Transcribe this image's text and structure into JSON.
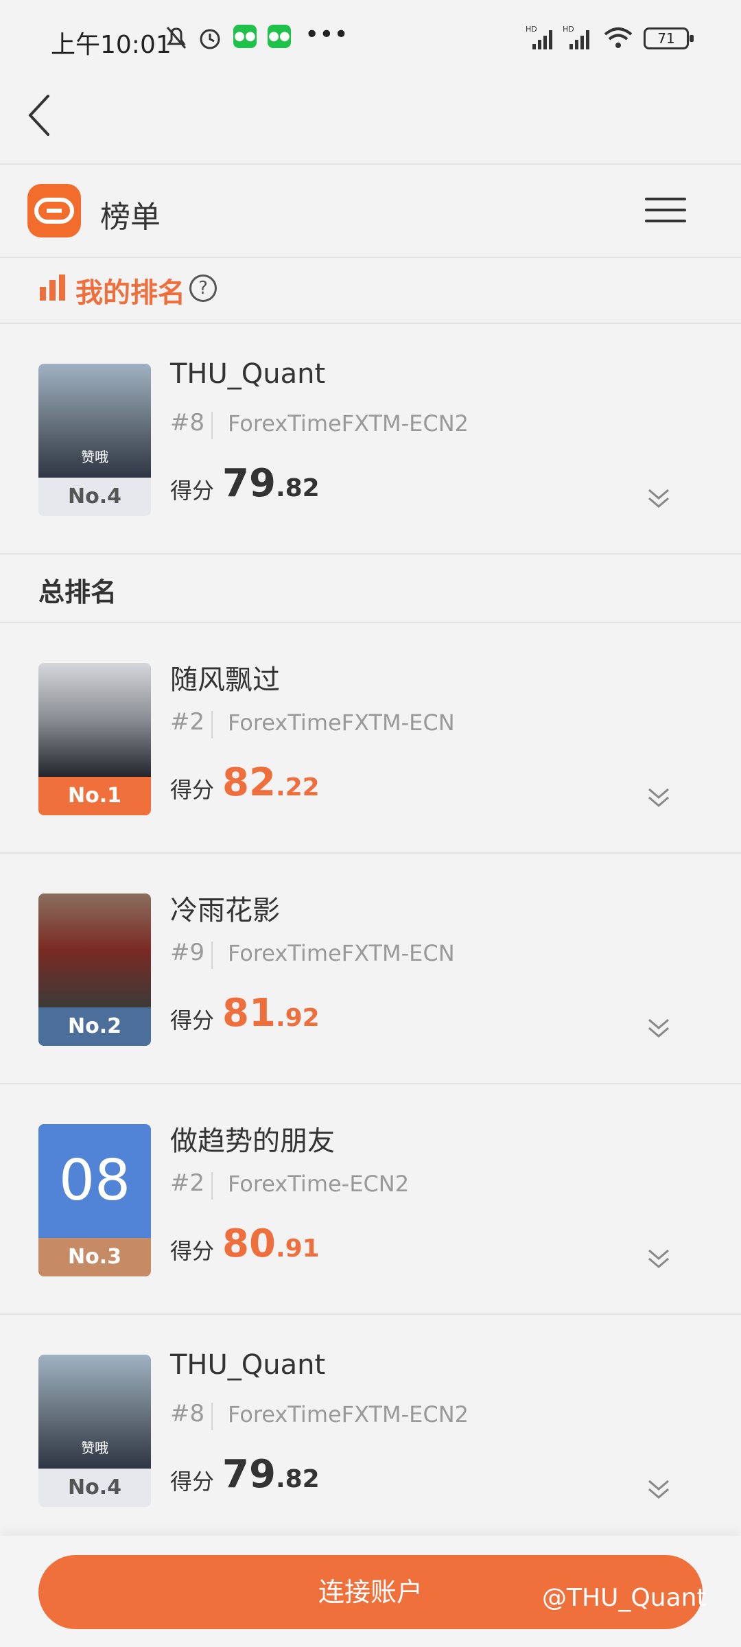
{
  "status_bar": {
    "time": "上午10:01",
    "battery": "71",
    "network_1": "HD",
    "network_2": "HD"
  },
  "app": {
    "title": "榜单"
  },
  "my_ranking": {
    "label": "我的排名",
    "help": "?",
    "entry": {
      "name": "THU_Quant",
      "rank": "#8",
      "broker": "ForexTimeFXTM-ECN2",
      "score_label": "得分",
      "score_int": "79",
      "score_dec": ".82",
      "tag": "No.4",
      "avatar_caption": "赞哦"
    }
  },
  "overall": {
    "label": "总排名",
    "entries": [
      {
        "name": "随风飘过",
        "rank": "#2",
        "broker": "ForexTimeFXTM-ECN",
        "score_label": "得分",
        "score_int": "82",
        "score_dec": ".22",
        "tag": "No.1"
      },
      {
        "name": "冷雨花影",
        "rank": "#9",
        "broker": "ForexTimeFXTM-ECN",
        "score_label": "得分",
        "score_int": "81",
        "score_dec": ".92",
        "tag": "No.2"
      },
      {
        "name": "做趋势的朋友",
        "rank": "#2",
        "broker": "ForexTime-ECN2",
        "score_label": "得分",
        "score_int": "80",
        "score_dec": ".91",
        "tag": "No.3",
        "avatar_text": "08"
      },
      {
        "name": "THU_Quant",
        "rank": "#8",
        "broker": "ForexTimeFXTM-ECN2",
        "score_label": "得分",
        "score_int": "79",
        "score_dec": ".82",
        "tag": "No.4",
        "avatar_caption": "赞哦"
      }
    ]
  },
  "bottom": {
    "connect_label": "连接账户",
    "watermark": "@THU_Quant"
  },
  "colors": {
    "accent": "#f0703c",
    "blue_avatar": "#5184d6"
  }
}
